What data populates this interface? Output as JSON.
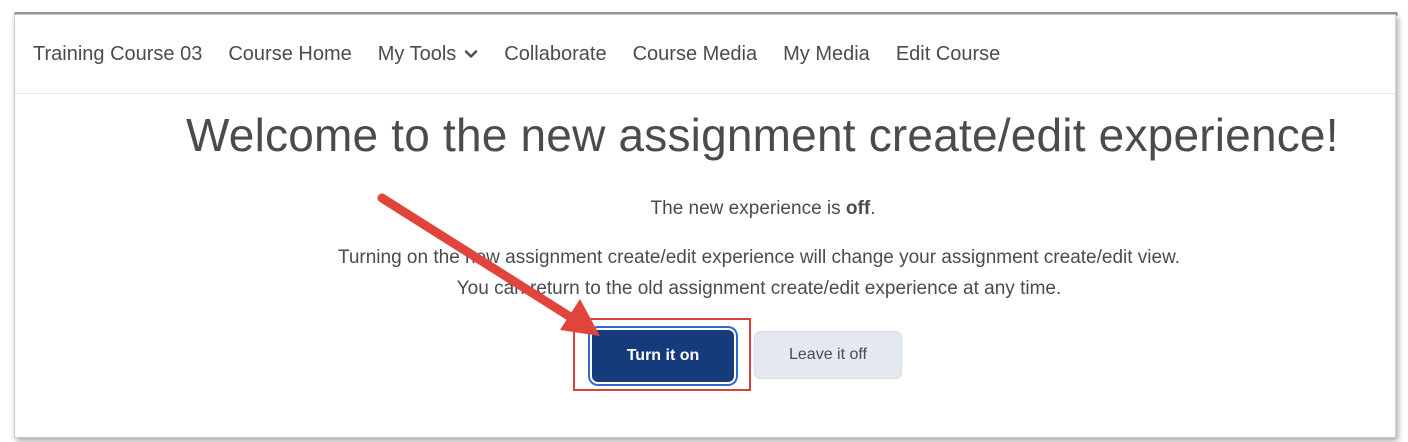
{
  "nav": {
    "items": [
      {
        "label": "Training Course 03"
      },
      {
        "label": "Course Home"
      },
      {
        "label": "My Tools"
      },
      {
        "label": "Collaborate"
      },
      {
        "label": "Course Media"
      },
      {
        "label": "My Media"
      },
      {
        "label": "Edit Course"
      }
    ]
  },
  "main": {
    "title": "Welcome to the new assignment create/edit experience!",
    "status_prefix": "The new experience is ",
    "status_value": "off",
    "status_suffix": ".",
    "description_line1": "Turning on the new assignment create/edit experience will change your assignment create/edit view.",
    "description_line2": "You can return to the old assignment create/edit experience at any time.",
    "primary_button": "Turn it on",
    "secondary_button": "Leave it off"
  },
  "colors": {
    "primary": "#153b7d",
    "annotation": "#e0443a"
  }
}
